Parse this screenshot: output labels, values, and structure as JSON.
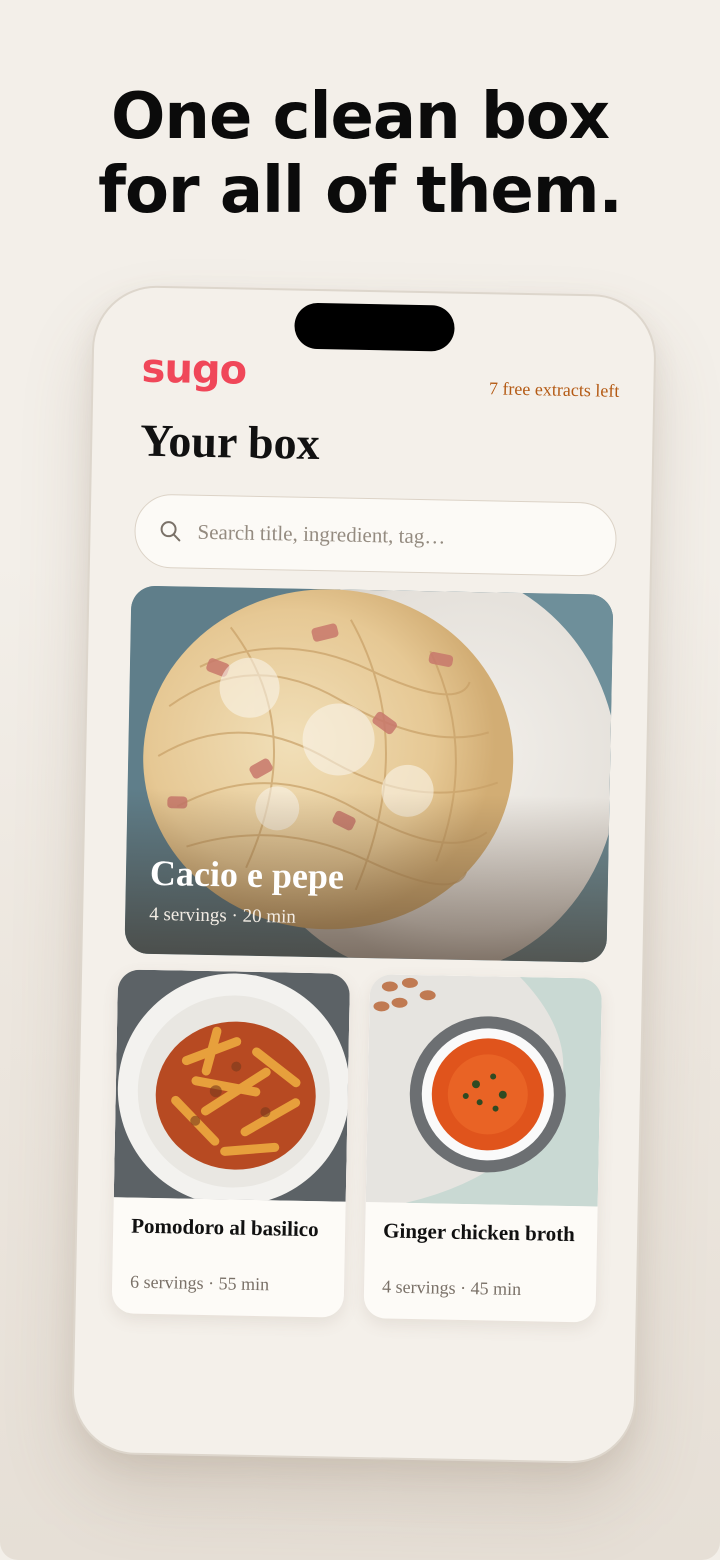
{
  "headline": {
    "line1": "One clean box",
    "line2": "for all of them."
  },
  "app": {
    "brand": "sugo",
    "credits": "7 free extracts left",
    "title": "Your box",
    "search": {
      "placeholder": "Search title, ingredient, tag…",
      "value": ""
    }
  },
  "recipes": [
    {
      "title": "Cacio e pepe",
      "meta": "4 servings · 20 min",
      "image": "spaghetti-carbonara-plate"
    },
    {
      "title": "Pomodoro al basilico",
      "meta": "6 servings · 55 min",
      "image": "penne-tomato-bowl"
    },
    {
      "title": "Ginger chicken broth",
      "meta": "4 servings · 45 min",
      "image": "tomato-soup-bowl"
    }
  ],
  "colors": {
    "brand": "#f04759",
    "credits": "#b45a14",
    "background": "#f3efe9"
  }
}
